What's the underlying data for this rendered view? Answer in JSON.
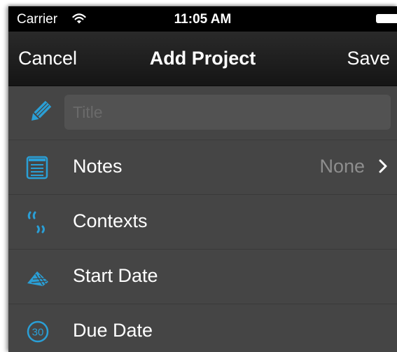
{
  "status_bar": {
    "carrier": "Carrier",
    "time": "11:05 AM"
  },
  "nav": {
    "cancel_label": "Cancel",
    "title": "Add Project",
    "save_label": "Save"
  },
  "form": {
    "title_placeholder": "Title",
    "title_value": "",
    "rows": [
      {
        "label": "Notes",
        "value": "None",
        "icon": "notes-icon"
      },
      {
        "label": "Contexts",
        "icon": "quote-icon"
      },
      {
        "label": "Start Date",
        "icon": "start-date-icon"
      },
      {
        "label": "Due Date",
        "icon": "due-date-icon",
        "icon_text": "30"
      }
    ]
  },
  "colors": {
    "accent": "#2a9fd6",
    "background": "#454545",
    "navbar": "#1c1c1c"
  }
}
